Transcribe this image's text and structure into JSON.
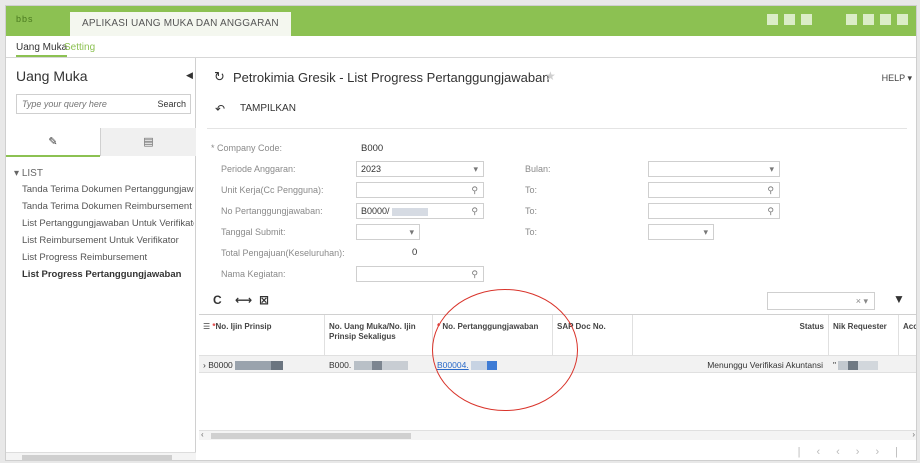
{
  "app": {
    "logo": "bbs",
    "title": "APLIKASI UANG MUKA DAN ANGGARAN"
  },
  "menu": {
    "uang_muka": "Uang Muka",
    "setting": "Setting"
  },
  "sidebar": {
    "title": "Uang Muka",
    "search_placeholder": "Type your query here",
    "search_button": "Search",
    "group": "LIST",
    "items": [
      "Tanda Terima Dokumen Pertanggungjawab",
      "Tanda Terima Dokumen Reimbursement",
      "List Pertanggungjawaban Untuk Verifikator",
      "List Reimbursement Untuk Verifikator",
      "List Progress Reimbursement",
      "List Progress Pertanggungjawaban"
    ]
  },
  "header": {
    "company": "Petrokimia Gresik",
    "separator": "-",
    "page_title": "List Progress Pertanggungjawaban",
    "help": "HELP ▾",
    "tampilkan": "TAMPILKAN"
  },
  "form": {
    "company_code_label": "* Company Code:",
    "company_code_value": "B000",
    "periode_label": "Periode Anggaran:",
    "periode_value": "2023",
    "unit_label": "Unit Kerja(Cc Pengguna):",
    "no_pj_label": "No Pertanggungjawaban:",
    "no_pj_value": "B0000/",
    "tanggal_label": "Tanggal Submit:",
    "total_label": "Total Pengajuan(Keseluruhan):",
    "total_value": "0",
    "nama_label": "Nama Kegiatan:",
    "bulan_label": "Bulan:",
    "to1_label": "To:",
    "to2_label": "To:",
    "to3_label": "To:"
  },
  "grid": {
    "search_clear": "× ▾",
    "columns": {
      "no_ijin": "No. Ijin Prinsip",
      "no_uang_muka": "No. Uang Muka/No. Ijin Prinsip Sekaligus",
      "no_pj": "No. Pertanggungjawaban",
      "sap_doc": "SAP Doc No.",
      "status": "Status",
      "nik": "Nik Requester",
      "acc": "Acc"
    },
    "row": {
      "no_ijin": "B0000",
      "no_uang_muka": "B000.",
      "no_pj": "B00004.",
      "status": "Menunggu Verifikasi Akuntansi",
      "nik": "\""
    }
  },
  "colors": {
    "accent_green": "#8cc152",
    "link_blue": "#2a6ac9",
    "highlight_red": "#d9342b"
  }
}
